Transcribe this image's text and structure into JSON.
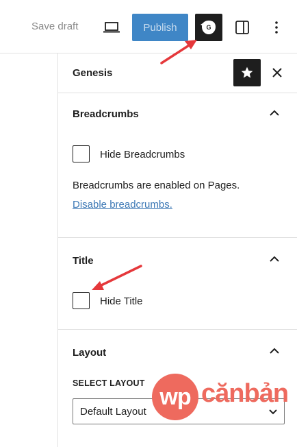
{
  "topbar": {
    "save_draft": "Save draft",
    "preview_icon": "laptop-icon",
    "publish": "Publish",
    "genesis_icon": "genesis-logo-icon",
    "genesis_badge": "G",
    "sidebar_icon": "sidebar-toggle-icon",
    "more_icon": "more-vertical-icon"
  },
  "sidebar": {
    "title": "Genesis",
    "pin_icon": "star-icon",
    "close_icon": "close-icon"
  },
  "panels": {
    "breadcrumbs": {
      "title": "Breadcrumbs",
      "checkbox_label": "Hide Breadcrumbs",
      "help_text": "Breadcrumbs are enabled on Pages.",
      "link": "Disable breadcrumbs."
    },
    "title": {
      "title": "Title",
      "checkbox_label": "Hide Title"
    },
    "layout": {
      "title": "Layout",
      "select_label": "SELECT LAYOUT",
      "select_value": "Default Layout"
    }
  },
  "watermark": {
    "circle_text": "wp",
    "text": "cănbản"
  },
  "colors": {
    "publish": "#3f86c6",
    "dark": "#1e1e1e",
    "link": "#3c78b5",
    "annotation_arrow": "#e5383b",
    "watermark": "#ee6a5e"
  }
}
